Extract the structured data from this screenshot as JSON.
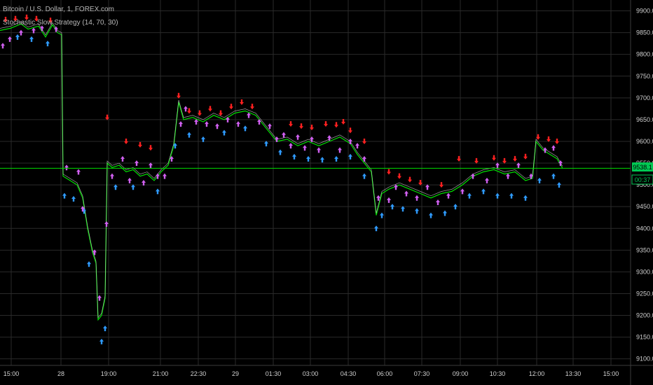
{
  "header": {
    "symbol": "Bitcoin / U.S. Dollar, 1, FOREX.com",
    "indicator": "Stochastic Slow Strategy (14, 70, 30)"
  },
  "price_badge": {
    "value": "9538.1",
    "countdown": "00:37",
    "color": "#00c853"
  },
  "chart_data": {
    "type": "line",
    "title": "Bitcoin / U.S. Dollar, 1, FOREX.com",
    "indicator": "Stochastic Slow Strategy (14, 70, 30)",
    "ylim": [
      9085,
      9925
    ],
    "y_ticks": [
      9100,
      9150,
      9200,
      9250,
      9300,
      9350,
      9400,
      9450,
      9500,
      9550,
      9600,
      9650,
      9700,
      9750,
      9800,
      9850,
      9900
    ],
    "y_tick_labels": [
      "9100.0",
      "9150.0",
      "9200.0",
      "9250.0",
      "9300.0",
      "9350.0",
      "9400.0",
      "9450.0",
      "9500.0",
      "9550.0",
      "9600.0",
      "9650.0",
      "9700.0",
      "9750.0",
      "9800.0",
      "9850.0",
      "9900.0"
    ],
    "x_ticks": [
      "15:00",
      "28",
      "19:00",
      "21:00",
      "22:30",
      "29",
      "01:30",
      "03:00",
      "04:30",
      "06:00",
      "07:30",
      "09:00",
      "10:30",
      "12:00",
      "13:30",
      "15:00"
    ],
    "last_price": 9538.1,
    "grid": true,
    "colors": {
      "background": "#000000",
      "grid": "#2a2a2a",
      "price_line": "#00e000",
      "buy_signal": "#2f9bff",
      "sell_signal": "#ff2020",
      "exit_signal": "#d060f0"
    },
    "series": [
      {
        "name": "",
        "points": [
          [
            0,
            9855
          ],
          [
            15,
            9860
          ],
          [
            30,
            9870
          ],
          [
            40,
            9858
          ],
          [
            55,
            9865
          ],
          [
            65,
            9840
          ],
          [
            75,
            9868
          ],
          [
            82,
            9850
          ],
          [
            88,
            9845
          ],
          [
            90,
            9520
          ],
          [
            100,
            9510
          ],
          [
            110,
            9500
          ],
          [
            118,
            9470
          ],
          [
            125,
            9400
          ],
          [
            132,
            9345
          ],
          [
            137,
            9320
          ],
          [
            140,
            9190
          ],
          [
            145,
            9200
          ],
          [
            150,
            9240
          ],
          [
            153,
            9550
          ],
          [
            160,
            9540
          ],
          [
            170,
            9545
          ],
          [
            180,
            9530
          ],
          [
            190,
            9535
          ],
          [
            200,
            9520
          ],
          [
            210,
            9525
          ],
          [
            220,
            9510
          ],
          [
            230,
            9530
          ],
          [
            240,
            9545
          ],
          [
            248,
            9590
          ],
          [
            255,
            9690
          ],
          [
            262,
            9650
          ],
          [
            275,
            9655
          ],
          [
            290,
            9645
          ],
          [
            305,
            9660
          ],
          [
            320,
            9650
          ],
          [
            335,
            9665
          ],
          [
            350,
            9670
          ],
          [
            365,
            9660
          ],
          [
            375,
            9640
          ],
          [
            385,
            9620
          ],
          [
            395,
            9600
          ],
          [
            410,
            9605
          ],
          [
            425,
            9590
          ],
          [
            440,
            9600
          ],
          [
            455,
            9590
          ],
          [
            470,
            9600
          ],
          [
            485,
            9610
          ],
          [
            500,
            9595
          ],
          [
            510,
            9570
          ],
          [
            520,
            9550
          ],
          [
            530,
            9530
          ],
          [
            537,
            9430
          ],
          [
            545,
            9480
          ],
          [
            555,
            9490
          ],
          [
            570,
            9500
          ],
          [
            585,
            9490
          ],
          [
            600,
            9480
          ],
          [
            615,
            9470
          ],
          [
            630,
            9480
          ],
          [
            645,
            9485
          ],
          [
            660,
            9500
          ],
          [
            675,
            9520
          ],
          [
            690,
            9530
          ],
          [
            705,
            9535
          ],
          [
            720,
            9525
          ],
          [
            735,
            9530
          ],
          [
            750,
            9510
          ],
          [
            760,
            9515
          ],
          [
            765,
            9600
          ],
          [
            775,
            9580
          ],
          [
            785,
            9570
          ],
          [
            795,
            9560
          ],
          [
            803,
            9538
          ]
        ]
      }
    ],
    "markers": {
      "sell": [
        [
          8,
          9880
        ],
        [
          22,
          9882
        ],
        [
          38,
          9885
        ],
        [
          52,
          9882
        ],
        [
          72,
          9878
        ],
        [
          153,
          9655
        ],
        [
          180,
          9600
        ],
        [
          200,
          9592
        ],
        [
          215,
          9585
        ],
        [
          255,
          9705
        ],
        [
          270,
          9670
        ],
        [
          285,
          9665
        ],
        [
          300,
          9675
        ],
        [
          315,
          9665
        ],
        [
          330,
          9680
        ],
        [
          345,
          9690
        ],
        [
          360,
          9680
        ],
        [
          415,
          9640
        ],
        [
          430,
          9635
        ],
        [
          445,
          9632
        ],
        [
          465,
          9640
        ],
        [
          480,
          9638
        ],
        [
          490,
          9645
        ],
        [
          500,
          9625
        ],
        [
          520,
          9600
        ],
        [
          555,
          9530
        ],
        [
          570,
          9520
        ],
        [
          585,
          9512
        ],
        [
          600,
          9505
        ],
        [
          630,
          9500
        ],
        [
          655,
          9560
        ],
        [
          680,
          9555
        ],
        [
          705,
          9562
        ],
        [
          720,
          9555
        ],
        [
          735,
          9560
        ],
        [
          750,
          9565
        ],
        [
          768,
          9610
        ],
        [
          783,
          9605
        ],
        [
          795,
          9600
        ]
      ],
      "buy": [
        [
          25,
          9840
        ],
        [
          45,
          9835
        ],
        [
          68,
          9825
        ],
        [
          92,
          9475
        ],
        [
          105,
          9468
        ],
        [
          120,
          9440
        ],
        [
          127,
          9318
        ],
        [
          145,
          9140
        ],
        [
          150,
          9170
        ],
        [
          165,
          9495
        ],
        [
          190,
          9495
        ],
        [
          225,
          9485
        ],
        [
          250,
          9590
        ],
        [
          270,
          9615
        ],
        [
          290,
          9605
        ],
        [
          320,
          9620
        ],
        [
          350,
          9630
        ],
        [
          380,
          9595
        ],
        [
          400,
          9575
        ],
        [
          420,
          9565
        ],
        [
          440,
          9560
        ],
        [
          460,
          9558
        ],
        [
          480,
          9560
        ],
        [
          500,
          9565
        ],
        [
          520,
          9520
        ],
        [
          537,
          9400
        ],
        [
          545,
          9430
        ],
        [
          560,
          9450
        ],
        [
          575,
          9445
        ],
        [
          595,
          9440
        ],
        [
          615,
          9430
        ],
        [
          635,
          9435
        ],
        [
          650,
          9450
        ],
        [
          670,
          9475
        ],
        [
          690,
          9485
        ],
        [
          710,
          9475
        ],
        [
          730,
          9475
        ],
        [
          750,
          9470
        ],
        [
          770,
          9510
        ],
        [
          790,
          9520
        ],
        [
          798,
          9500
        ]
      ],
      "exit": [
        [
          4,
          9820
        ],
        [
          14,
          9835
        ],
        [
          30,
          9850
        ],
        [
          48,
          9855
        ],
        [
          60,
          9860
        ],
        [
          80,
          9858
        ],
        [
          95,
          9540
        ],
        [
          112,
          9530
        ],
        [
          118,
          9445
        ],
        [
          135,
          9345
        ],
        [
          142,
          9240
        ],
        [
          152,
          9410
        ],
        [
          160,
          9520
        ],
        [
          175,
          9560
        ],
        [
          185,
          9510
        ],
        [
          195,
          9550
        ],
        [
          205,
          9505
        ],
        [
          215,
          9545
        ],
        [
          225,
          9520
        ],
        [
          235,
          9520
        ],
        [
          245,
          9560
        ],
        [
          258,
          9640
        ],
        [
          265,
          9675
        ],
        [
          280,
          9645
        ],
        [
          295,
          9640
        ],
        [
          310,
          9635
        ],
        [
          325,
          9650
        ],
        [
          340,
          9640
        ],
        [
          355,
          9660
        ],
        [
          370,
          9645
        ],
        [
          385,
          9635
        ],
        [
          395,
          9605
        ],
        [
          405,
          9615
        ],
        [
          415,
          9590
        ],
        [
          425,
          9610
        ],
        [
          435,
          9585
        ],
        [
          445,
          9605
        ],
        [
          455,
          9580
        ],
        [
          470,
          9608
        ],
        [
          485,
          9580
        ],
        [
          500,
          9600
        ],
        [
          510,
          9590
        ],
        [
          520,
          9560
        ],
        [
          540,
          9470
        ],
        [
          555,
          9465
        ],
        [
          565,
          9495
        ],
        [
          580,
          9480
        ],
        [
          595,
          9470
        ],
        [
          610,
          9495
        ],
        [
          625,
          9460
        ],
        [
          640,
          9475
        ],
        [
          660,
          9485
        ],
        [
          675,
          9520
        ],
        [
          695,
          9510
        ],
        [
          710,
          9545
        ],
        [
          725,
          9520
        ],
        [
          740,
          9545
        ],
        [
          758,
          9520
        ],
        [
          778,
          9580
        ],
        [
          790,
          9585
        ],
        [
          800,
          9550
        ]
      ]
    }
  }
}
